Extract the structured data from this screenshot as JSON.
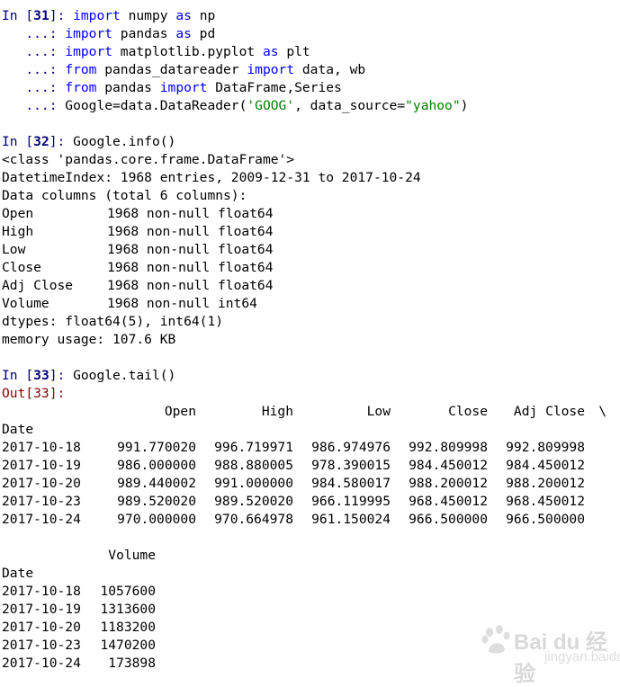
{
  "cell31": {
    "prompt_in": "In [",
    "prompt_num": "31",
    "prompt_end": "]: ",
    "cont_prompt": "   ...: ",
    "line1": {
      "kw1": "import",
      "rest1": " numpy ",
      "kw2": "as",
      "rest2": " np"
    },
    "line2": {
      "kw1": "import",
      "rest1": " pandas ",
      "kw2": "as",
      "rest2": " pd"
    },
    "line3": {
      "kw1": "import",
      "rest1": " matplotlib.pyplot ",
      "kw2": "as",
      "rest2": " plt"
    },
    "line4": {
      "kw1": "from",
      "rest1": " pandas_datareader ",
      "kw2": "import",
      "rest2": " data, wb"
    },
    "line5": {
      "kw1": "from",
      "rest1": " pandas ",
      "kw2": "import",
      "rest2": " DataFrame,Series"
    },
    "line6": {
      "pre": "Google=data.DataReader(",
      "str1": "'GOOG'",
      "mid": ", data_source=",
      "str2": "\"yahoo\"",
      "post": ")"
    }
  },
  "cell32": {
    "prompt_in": "In [",
    "prompt_num": "32",
    "prompt_end": "]: ",
    "code": "Google.info()",
    "output": {
      "class_line": "<class 'pandas.core.frame.DataFrame'>",
      "index_line": "DatetimeIndex: 1968 entries, 2009-12-31 to 2017-10-24",
      "columns_line": "Data columns (total 6 columns):",
      "columns": [
        {
          "name": "Open",
          "info": "1968 non-null float64"
        },
        {
          "name": "High",
          "info": "1968 non-null float64"
        },
        {
          "name": "Low",
          "info": "1968 non-null float64"
        },
        {
          "name": "Close",
          "info": "1968 non-null float64"
        },
        {
          "name": "Adj Close",
          "info": "1968 non-null float64"
        },
        {
          "name": "Volume",
          "info": "1968 non-null int64"
        }
      ],
      "dtypes_line": "dtypes: float64(5), int64(1)",
      "memory_line": "memory usage: 107.6 KB"
    }
  },
  "cell33": {
    "prompt_in": "In [",
    "prompt_num": "33",
    "prompt_end": "]: ",
    "code": "Google.tail()",
    "out_prompt": "Out[33]:",
    "table1": {
      "headers": [
        "Open",
        "High",
        "Low",
        "Close",
        "Adj Close"
      ],
      "continuation": "\\",
      "index_name": "Date",
      "rows": [
        {
          "date": "2017-10-18",
          "values": [
            "991.770020",
            "996.719971",
            "986.974976",
            "992.809998",
            "992.809998"
          ]
        },
        {
          "date": "2017-10-19",
          "values": [
            "986.000000",
            "988.880005",
            "978.390015",
            "984.450012",
            "984.450012"
          ]
        },
        {
          "date": "2017-10-20",
          "values": [
            "989.440002",
            "991.000000",
            "984.580017",
            "988.200012",
            "988.200012"
          ]
        },
        {
          "date": "2017-10-23",
          "values": [
            "989.520020",
            "989.520020",
            "966.119995",
            "968.450012",
            "968.450012"
          ]
        },
        {
          "date": "2017-10-24",
          "values": [
            "970.000000",
            "970.664978",
            "961.150024",
            "966.500000",
            "966.500000"
          ]
        }
      ]
    },
    "table2": {
      "header": "Volume",
      "index_name": "Date",
      "rows": [
        {
          "date": "2017-10-18",
          "value": "1057600"
        },
        {
          "date": "2017-10-19",
          "value": "1313600"
        },
        {
          "date": "2017-10-20",
          "value": "1183200"
        },
        {
          "date": "2017-10-23",
          "value": "1470200"
        },
        {
          "date": "2017-10-24",
          "value": "173898"
        }
      ]
    }
  },
  "watermark": {
    "text": "Bai du 经验",
    "sub": "jingyan.baidu.com"
  },
  "colors": {
    "keyword": "#0000ff",
    "string": "#008000",
    "in_prompt": "#000080",
    "out_prompt": "#8b0000"
  }
}
